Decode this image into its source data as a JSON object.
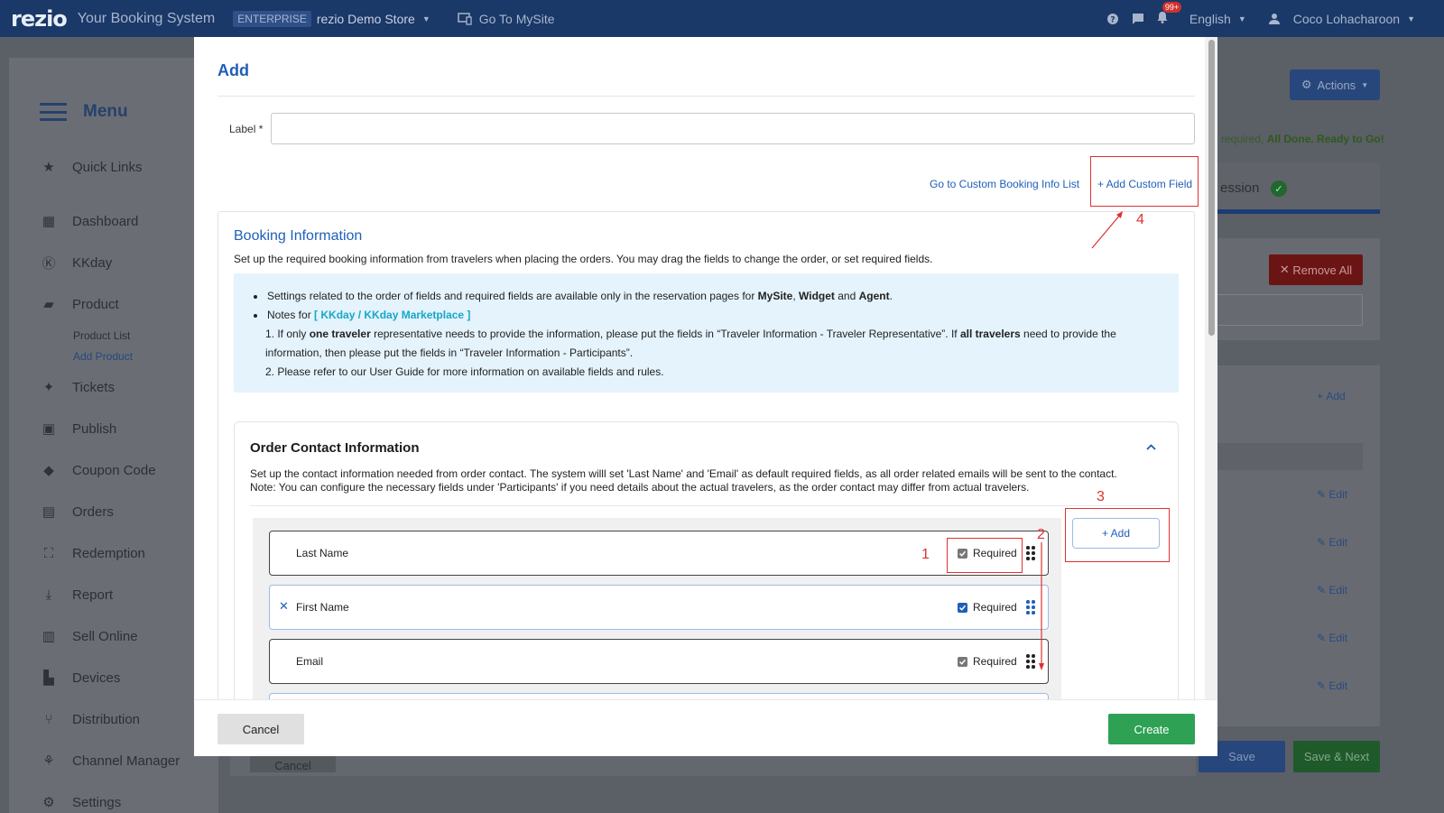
{
  "topbar": {
    "logo": "rezio",
    "tagline": "Your Booking System",
    "plan_badge": "ENTERPRISE",
    "store": "rezio Demo Store",
    "go_mysite": "Go To MySite",
    "notif_count": "99+",
    "language": "English",
    "user": "Coco Lohacharoon"
  },
  "sidebar": {
    "title": "Menu",
    "items": [
      {
        "label": "Quick Links",
        "icon": "star-icon"
      },
      {
        "label": "Dashboard",
        "icon": "dashboard-icon"
      },
      {
        "label": "KKday",
        "icon": "kkday-icon"
      },
      {
        "label": "Product",
        "icon": "product-icon"
      },
      {
        "label": "Tickets",
        "icon": "ticket-icon"
      },
      {
        "label": "Publish",
        "icon": "calendar-icon"
      },
      {
        "label": "Coupon Code",
        "icon": "tag-icon"
      },
      {
        "label": "Orders",
        "icon": "document-icon"
      },
      {
        "label": "Redemption",
        "icon": "scan-icon"
      },
      {
        "label": "Report",
        "icon": "download-icon"
      },
      {
        "label": "Sell Online",
        "icon": "store-icon"
      },
      {
        "label": "Devices",
        "icon": "printer-icon"
      },
      {
        "label": "Distribution",
        "icon": "distribution-icon"
      },
      {
        "label": "Channel Manager",
        "icon": "hub-icon"
      },
      {
        "label": "Settings",
        "icon": "gear-icon"
      }
    ],
    "product_sub": [
      "Product List",
      "Add Product"
    ]
  },
  "background": {
    "actions": "Actions",
    "done_prefix": "required,",
    "done_text": "All Done. Ready to Go!",
    "tab_label": "ession",
    "remove_all": "Remove All",
    "add": "Add",
    "edit": "Edit",
    "save": "Save",
    "save_next": "Save & Next",
    "cancel": "Cancel"
  },
  "modal": {
    "title": "Add",
    "label_field": {
      "label": "Label *",
      "value": "",
      "placeholder": ""
    },
    "link_list": "Go to Custom Booking Info List",
    "link_add_custom": "+ Add Custom Field",
    "booking": {
      "title": "Booking Information",
      "desc": "Set up the required booking information from travelers when placing the orders. You may drag the fields to change the order, or set required fields.",
      "note1_a": "Settings related to the order of fields and required fields are available only in the reservation pages for ",
      "note1_b": "MySite",
      "note1_c": ", ",
      "note1_d": "Widget",
      "note1_e": " and ",
      "note1_f": "Agent",
      "note1_g": ".",
      "note2_a": "Notes for ",
      "note2_b": "[ KKday / KKday Marketplace ]",
      "sub1_a": "1. If only ",
      "sub1_b": "one traveler",
      "sub1_c": " representative needs to provide the information, please put the fields in “Traveler Information - Traveler Representative”. If ",
      "sub1_d": "all travelers",
      "sub1_e": " need to provide the",
      "sub1_line2": "information, then please put the fields in “Traveler Information - Participants”.",
      "sub2": "2. Please refer to our User Guide for more information on available fields and rules."
    },
    "contact": {
      "title": "Order Contact Information",
      "desc_line1": "Set up the contact information needed from order contact. The system willl set 'Last Name' and 'Email' as default required fields, as all order related emails will be sent to the contact.",
      "desc_line2": "Note: You can configure the necessary fields under 'Participants' if you need details about the actual travelers, as the order contact may differ from actual travelers.",
      "add_button": "+ Add",
      "fields": [
        {
          "name": "Last Name",
          "required_label": "Required",
          "required": true,
          "locked": true
        },
        {
          "name": "First Name",
          "required_label": "Required",
          "required": true,
          "locked": false
        },
        {
          "name": "Email",
          "required_label": "Required",
          "required": true,
          "locked": true
        }
      ]
    },
    "footer": {
      "cancel": "Cancel",
      "create": "Create"
    },
    "annotations": [
      "1",
      "2",
      "3",
      "4"
    ]
  },
  "colors": {
    "primary": "#1f5fb8",
    "topbar": "#1a3868",
    "create": "#2ea155",
    "annotation": "#e03030",
    "info_bg": "#e4f3fc"
  }
}
